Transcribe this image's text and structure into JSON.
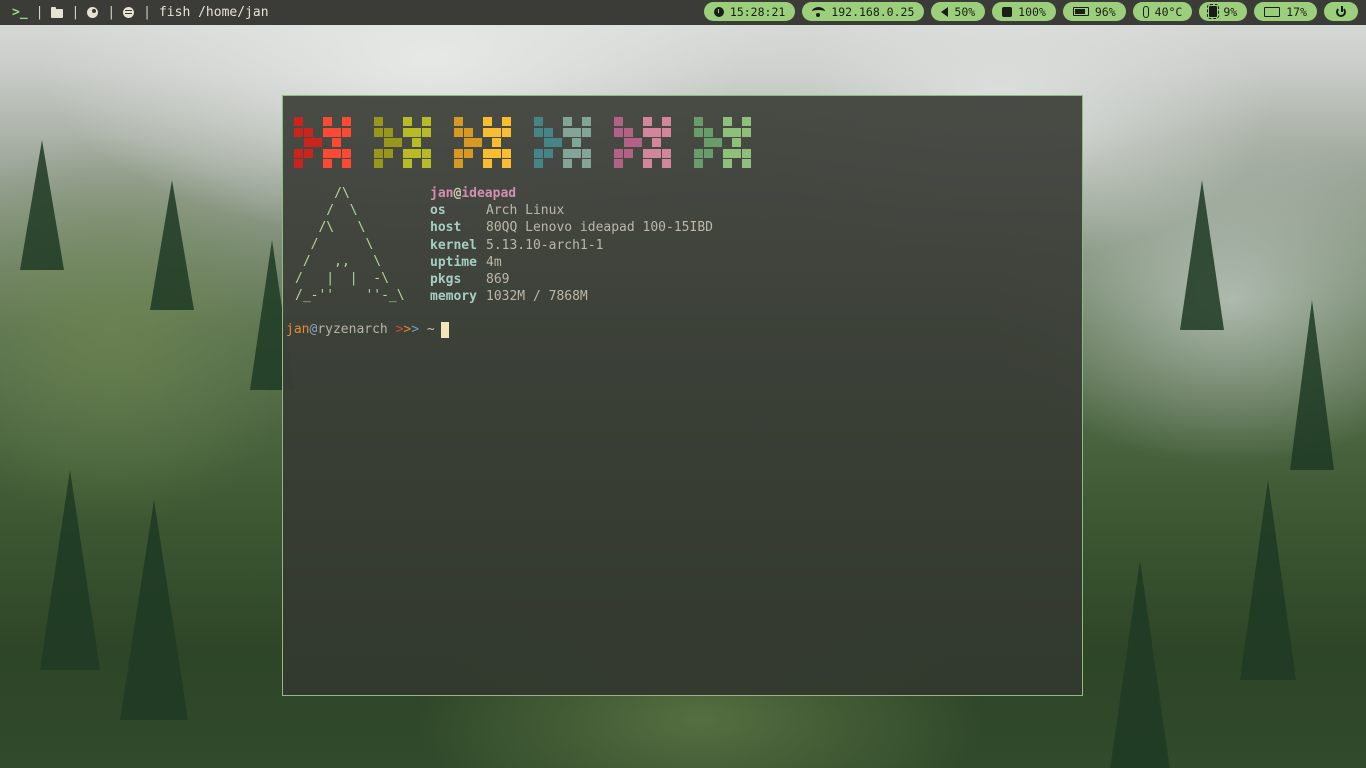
{
  "topbar": {
    "prompt_glyph": ">_",
    "separator": "|",
    "workspace_icons": [
      "folder-icon",
      "pie-icon",
      "spotify-icon"
    ],
    "window_title": "fish /home/jan",
    "modules": {
      "time": "15:28:21",
      "ip": "192.168.0.25",
      "volume": "50%",
      "cpu": "100%",
      "battery": "96%",
      "temperature": "40°C",
      "cpu_usage": "9%",
      "memory": "17%"
    },
    "accent": "#9ccf7b"
  },
  "terminal": {
    "palette_colors": [
      [
        "#cc241d",
        "#fb4934"
      ],
      [
        "#98971a",
        "#b8bb26"
      ],
      [
        "#d79921",
        "#fabd2f"
      ],
      [
        "#458588",
        "#83a598"
      ],
      [
        "#b16286",
        "#d3869b"
      ],
      [
        "#689d6a",
        "#8ec07c"
      ]
    ],
    "ascii_logo": "     /\\\n    /  \\\n   /\\   \\\n  /      \\\n /   ,,   \\\n/   |  |  -\\\n/_-''    ''-_\\",
    "fetch": {
      "user": "jan",
      "at": "@",
      "host": "ideapad",
      "rows": [
        {
          "key": "os",
          "value": "Arch Linux"
        },
        {
          "key": "host",
          "value": "80QQ Lenovo ideapad 100-15IBD"
        },
        {
          "key": "kernel",
          "value": "5.13.10-arch1-1"
        },
        {
          "key": "uptime",
          "value": "4m"
        },
        {
          "key": "pkgs",
          "value": "869"
        },
        {
          "key": "memory",
          "value": "1032M / 7868M"
        }
      ]
    },
    "prompt": {
      "user": "jan",
      "at": "@",
      "host": "ryzenarch",
      "arrow1": ">",
      "arrow2": ">",
      "arrow3": ">",
      "cwd": "~"
    }
  }
}
